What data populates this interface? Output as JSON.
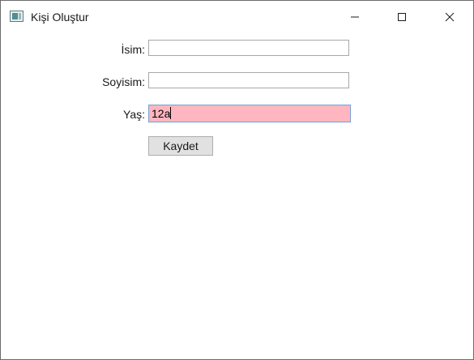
{
  "window": {
    "title": "Kişi Oluştur",
    "app_icon": "window-app-icon",
    "controls": {
      "minimize_icon": "minimize-icon",
      "maximize_icon": "maximize-icon",
      "close_icon": "close-icon"
    }
  },
  "form": {
    "name_label": "İsim:",
    "name_value": "",
    "surname_label": "Soyisim:",
    "surname_value": "",
    "age_label": "Yaş:",
    "age_value": "12a",
    "save_label": "Kaydet"
  },
  "colors": {
    "error_background": "#FFB6C1",
    "error_border": "#7A9FD0",
    "button_background": "#E1E1E1"
  }
}
